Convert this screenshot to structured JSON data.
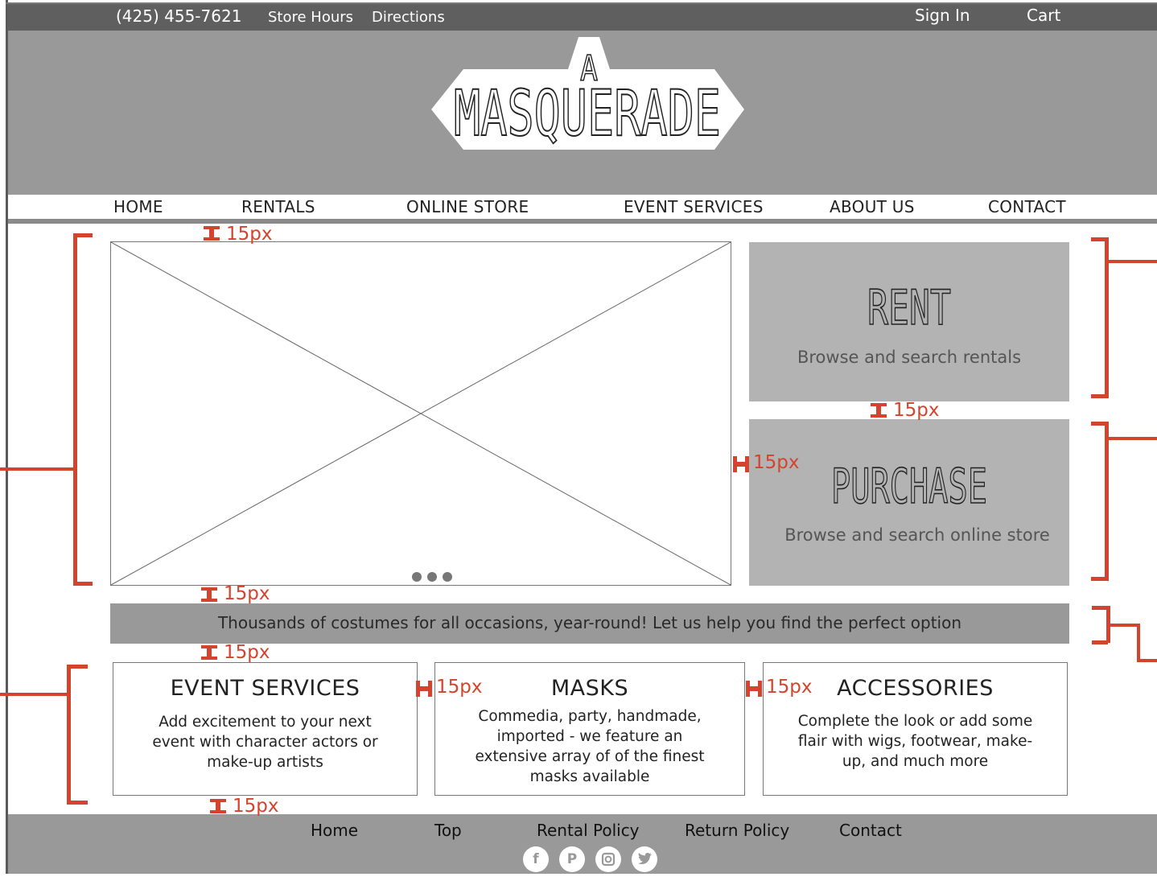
{
  "topbar": {
    "phone": "(425) 455-7621",
    "store_hours": "Store Hours",
    "directions": "Directions",
    "sign_in": "Sign In",
    "cart": "Cart"
  },
  "logo": {
    "line1": "A",
    "line2": "MASQUERADE"
  },
  "nav": {
    "items": [
      "HOME",
      "RENTALS",
      "ONLINE STORE",
      "EVENT SERVICES",
      "ABOUT US",
      "CONTACT"
    ]
  },
  "carousel": {
    "dots": 3
  },
  "rent": {
    "title": "RENT",
    "subtitle": "Browse and search rentals"
  },
  "purchase": {
    "title": "PURCHASE",
    "subtitle": "Browse and search online store"
  },
  "banner": {
    "text": "Thousands of costumes for all occasions, year-round! Let us help you find the perfect option"
  },
  "cards": [
    {
      "title": "EVENT SERVICES",
      "body": "Add excitement to your next event with character actors or make-up artists"
    },
    {
      "title": "MASKS",
      "body": "Commedia, party, handmade, imported - we feature an extensive array of of the finest masks available"
    },
    {
      "title": "ACCESSORIES",
      "body": "Complete the look or add some flair with wigs, footwear, make-up, and much more"
    }
  ],
  "footer": {
    "links": [
      "Home",
      "Top",
      "Rental Policy",
      "Return Policy",
      "Contact"
    ],
    "social_icons": [
      "facebook-icon",
      "pinterest-icon",
      "instagram-icon",
      "twitter-icon"
    ]
  },
  "annotations": {
    "spacing_label": "15px",
    "color": "#d4432e"
  },
  "colors": {
    "topbar": "#5f5f5f",
    "header": "#999999",
    "cta": "#b3b3b3",
    "banner": "#999999",
    "footer": "#999999"
  }
}
